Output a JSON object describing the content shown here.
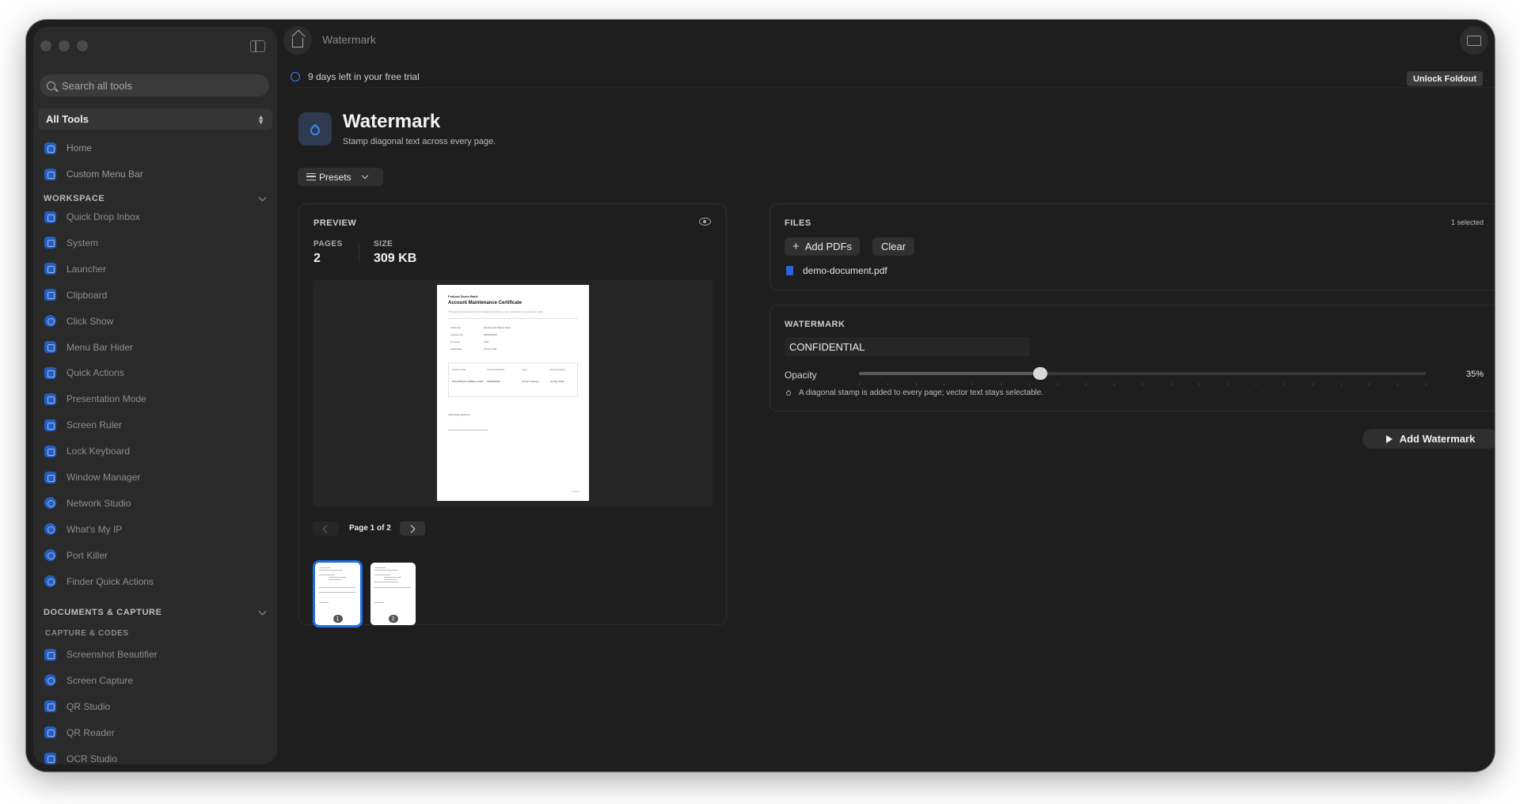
{
  "window": {
    "title": "Watermark"
  },
  "sidebar": {
    "search_placeholder": "Search all tools",
    "tools_select": "All Tools",
    "top_items": [
      {
        "label": "Home",
        "icon": "home-icon"
      },
      {
        "label": "Custom Menu Bar",
        "icon": "menu-bar-icon"
      }
    ],
    "workspace": {
      "title": "WORKSPACE",
      "items": [
        {
          "label": "Quick Drop Inbox",
          "icon": "inbox-icon"
        },
        {
          "label": "System",
          "icon": "system-icon"
        },
        {
          "label": "Launcher",
          "icon": "launcher-icon"
        },
        {
          "label": "Clipboard",
          "icon": "clipboard-icon"
        },
        {
          "label": "Click Show",
          "icon": "click-show-icon"
        },
        {
          "label": "Menu Bar Hider",
          "icon": "menu-bar-hider-icon"
        },
        {
          "label": "Quick Actions",
          "icon": "quick-actions-icon"
        },
        {
          "label": "Presentation Mode",
          "icon": "presentation-icon"
        },
        {
          "label": "Screen Ruler",
          "icon": "ruler-icon"
        },
        {
          "label": "Lock Keyboard",
          "icon": "lock-icon"
        },
        {
          "label": "Window Manager",
          "icon": "window-manager-icon"
        },
        {
          "label": "Network Studio",
          "icon": "network-icon"
        },
        {
          "label": "What's My IP",
          "icon": "globe-icon"
        },
        {
          "label": "Port Killer",
          "icon": "port-killer-icon"
        },
        {
          "label": "Finder Quick Actions",
          "icon": "finder-actions-icon"
        }
      ]
    },
    "documents": {
      "title": "DOCUMENTS & CAPTURE",
      "subtitle": "CAPTURE & CODES",
      "items": [
        {
          "label": "Screenshot Beautifier",
          "icon": "screenshot-icon"
        },
        {
          "label": "Screen Capture",
          "icon": "capture-icon"
        },
        {
          "label": "QR Studio",
          "icon": "qr-icon"
        },
        {
          "label": "QR Reader",
          "icon": "qr-reader-icon"
        },
        {
          "label": "OCR Studio",
          "icon": "ocr-icon"
        }
      ]
    }
  },
  "topbar": {
    "trial_text": "9 days left in your free trial",
    "unlock_label": "Unlock Foldout"
  },
  "main": {
    "title": "Watermark",
    "subtitle": "Stamp diagonal text across every page.",
    "presets_label": "Presets",
    "preview": {
      "label": "PREVIEW",
      "pages_label": "PAGES",
      "pages_value": "2",
      "size_label": "SIZE",
      "size_value": "309 KB",
      "pager_text": "Page 1 of 2",
      "thumbs": [
        "1",
        "2"
      ],
      "document": {
        "bank": "Foldout Demo Bank",
        "title": "Account Maintenance Certificate",
        "desc": "This sample document shows formatting consistency only. It contains no real account data.",
        "rows": [
          {
            "k": "Customer",
            "v": "Muhammad Nabeel Asad"
          },
          {
            "k": "Account No.",
            "v": "0000000000"
          },
          {
            "k": "Currency",
            "v": "PKR"
          },
          {
            "k": "Issue Date",
            "v": "21 Apr 2026"
          }
        ],
        "table_headers": [
          "Account Title",
          "Account Number",
          "Type",
          "Opening Date"
        ],
        "table_cells": [
          "MUHAMMAD NABEEL ASAD",
          "0000000000",
          "Current Savings",
          "01 May 2020"
        ],
        "signature": "Authorized signature",
        "page_no": "Page 1"
      }
    },
    "files": {
      "label": "FILES",
      "selected": "1 selected",
      "add_label": "Add PDFs",
      "clear_label": "Clear",
      "file_name": "demo-document.pdf"
    },
    "watermark": {
      "label": "WATERMARK",
      "text_value": "CONFIDENTIAL",
      "opacity_label": "Opacity",
      "opacity_value": "35%",
      "opacity_level": 0.32,
      "hint": "A diagonal stamp is added to every page; vector text stays selectable."
    },
    "action_label": "Add Watermark"
  },
  "colors": {
    "accent": "#1e6ee8",
    "window_bg": "#1e1e1e",
    "sidebar_bg": "#2a2a2a"
  }
}
